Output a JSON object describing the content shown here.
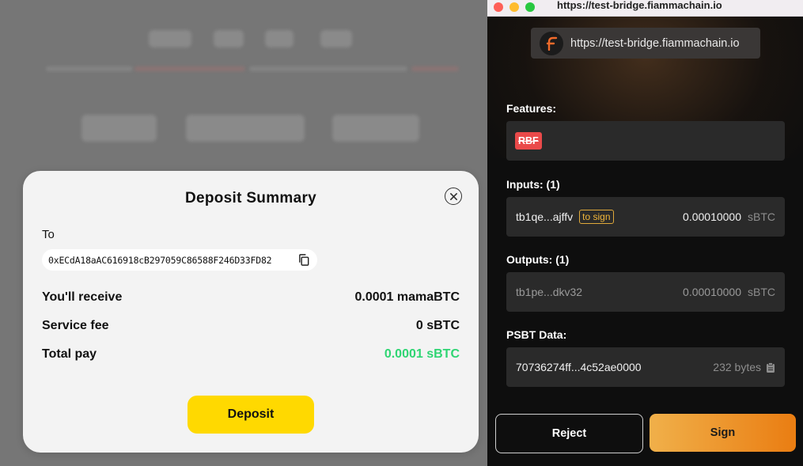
{
  "modal": {
    "title": "Deposit Summary",
    "to_label": "To",
    "to_address": "0xECdA18aAC616918cB297059C86588F246D33FD82",
    "rows": [
      {
        "label": "You'll receive",
        "value": "0.0001 mamaBTC"
      },
      {
        "label": "Service fee",
        "value": "0 sBTC"
      },
      {
        "label": "Total pay",
        "value": "0.0001 sBTC"
      }
    ],
    "deposit_label": "Deposit",
    "colors": {
      "accent": "#ffd900",
      "total_value": "#2ed573"
    }
  },
  "extension": {
    "window_title": "https://test-bridge.fiammachain.io",
    "origin_url": "https://test-bridge.fiammachain.io",
    "features": {
      "label": "Features:",
      "badges": [
        "RBF"
      ]
    },
    "inputs": {
      "label": "Inputs: (1)",
      "items": [
        {
          "address": "tb1qe...ajffv",
          "tag": "to sign",
          "amount": "0.00010000",
          "unit": "sBTC"
        }
      ]
    },
    "outputs": {
      "label": "Outputs: (1)",
      "items": [
        {
          "address": "tb1pe...dkv32",
          "amount": "0.00010000",
          "unit": "sBTC"
        }
      ]
    },
    "psbt": {
      "label": "PSBT Data:",
      "data": "70736274ff...4c52ae0000",
      "size": "232 bytes"
    },
    "reject_label": "Reject",
    "sign_label": "Sign",
    "colors": {
      "sign_gradient_start": "#f0b04a",
      "sign_gradient_end": "#ea7d12",
      "rbf_badge": "#ea4a4a",
      "to_sign_tag": "#f0b63a"
    }
  }
}
